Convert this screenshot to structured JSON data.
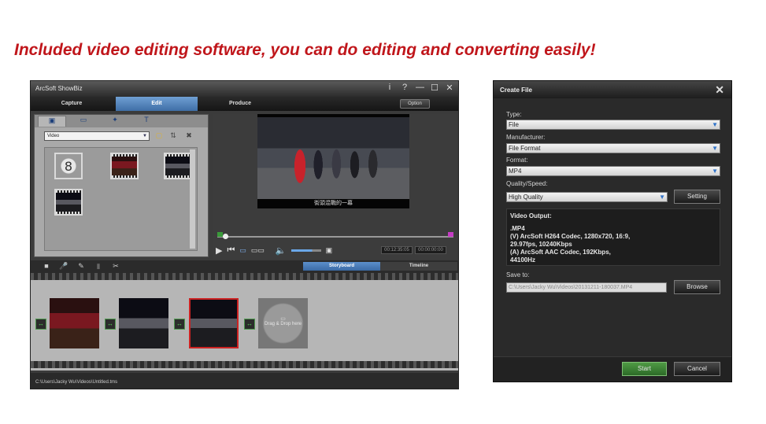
{
  "headline": "Included video editing software, you can do editing and converting easily!",
  "showbiz": {
    "title": "ArcSoft ShowBiz",
    "window_controls": [
      "i",
      "?",
      "—",
      "☐",
      "✕"
    ],
    "tabs": [
      {
        "label": "Capture",
        "active": false
      },
      {
        "label": "Edit",
        "active": true
      },
      {
        "label": "Produce",
        "active": false
      }
    ],
    "option_label": "Option",
    "library": {
      "tab_icons": [
        "media-library-icon",
        "transition-icon",
        "effects-icon",
        "text-icon"
      ],
      "category": "Video",
      "countdown_number": "8",
      "thumbnails": [
        "countdown-clip",
        "red-scene-clip",
        "dark-scene-clip",
        "street-scene-clip"
      ]
    },
    "preview": {
      "subtitle": "街頭混戰的一幕",
      "timecode_current": "00:12:35:05",
      "timecode_total": "00:00:00:00"
    },
    "storyboard_tabs": [
      {
        "label": "Storyboard",
        "active": true
      },
      {
        "label": "Timeline",
        "active": false
      }
    ],
    "drop_here": "Drag & Drop here",
    "status_path": "C:\\Users\\Jacky Wu\\Videos\\Untitled.tms"
  },
  "create_file": {
    "title": "Create File",
    "type_label": "Type:",
    "type_value": "File",
    "manufacturer_label": "Manufacturer:",
    "manufacturer_value": "File Format",
    "format_label": "Format:",
    "format_value": "MP4",
    "quality_label": "Quality/Speed:",
    "quality_value": "High Quality",
    "setting_button": "Setting",
    "output_heading": "Video Output:",
    "output_lines": [
      ".MP4",
      "(V) ArcSoft H264 Codec, 1280x720, 16:9,",
      "29.97fps, 10240Kbps",
      "(A) ArcSoft AAC Codec, 192Kbps,",
      "44100Hz"
    ],
    "save_label": "Save to:",
    "save_path": "C:\\Users\\Jacky Wu\\Videos\\20131211-180037.MP4",
    "browse_button": "Browse",
    "start_button": "Start",
    "cancel_button": "Cancel"
  },
  "colors": {
    "headline": "#c0161b",
    "active_tab": "#3f6ea6",
    "start_button": "#3a7e35",
    "dropdown_arrow": "#2f73c9",
    "selected_clip_border": "#cc2222"
  }
}
